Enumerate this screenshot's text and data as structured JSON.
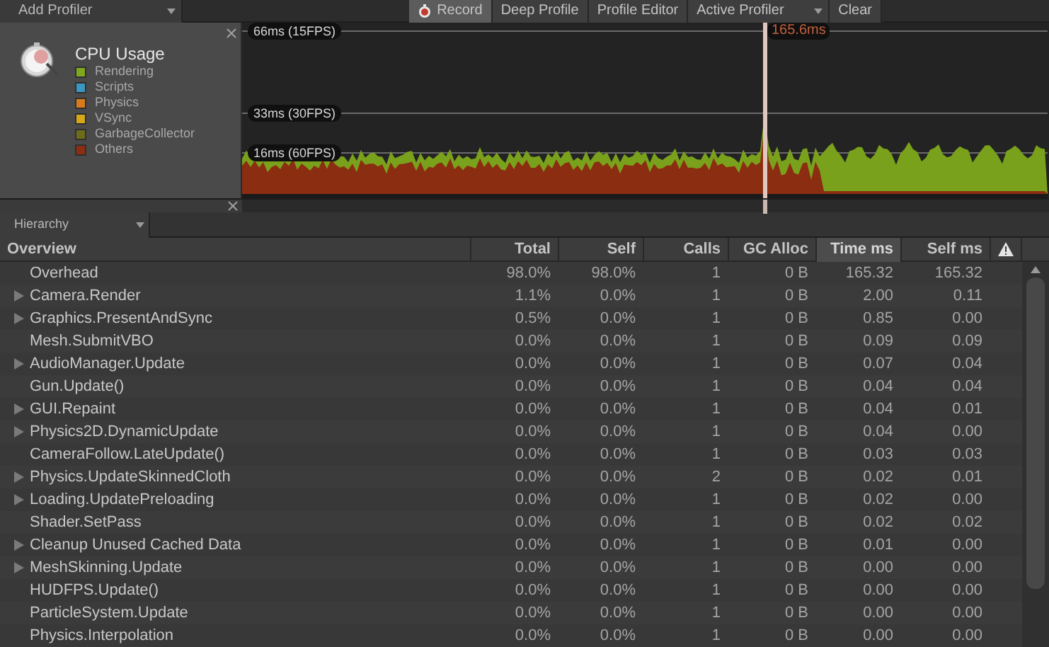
{
  "toolbar": {
    "add_profiler": "Add Profiler",
    "buttons": [
      {
        "label": "Record",
        "kind": "record",
        "selected": true
      },
      {
        "label": "Deep Profile",
        "kind": "plain",
        "selected": false
      },
      {
        "label": "Profile Editor",
        "kind": "plain",
        "selected": false
      },
      {
        "label": "Active Profiler",
        "kind": "dropdown",
        "selected": false
      },
      {
        "label": "Clear",
        "kind": "plain",
        "selected": false
      }
    ]
  },
  "cpu_panel": {
    "title": "CPU Usage",
    "legend": [
      {
        "label": "Rendering",
        "color": "#7fa81e"
      },
      {
        "label": "Scripts",
        "color": "#3c96c0"
      },
      {
        "label": "Physics",
        "color": "#d87b1c"
      },
      {
        "label": "VSync",
        "color": "#d4a81a"
      },
      {
        "label": "GarbageCollector",
        "color": "#6c6c1c"
      },
      {
        "label": "Others",
        "color": "#8b2d10"
      }
    ]
  },
  "graph": {
    "lines": [
      "66ms (15FPS)",
      "33ms (30FPS)",
      "16ms (60FPS)"
    ],
    "selected_frame": "165.6ms"
  },
  "view_mode": "Hierarchy",
  "table": {
    "columns": [
      {
        "label": "Overview",
        "selected": false
      },
      {
        "label": "Total",
        "selected": false
      },
      {
        "label": "Self",
        "selected": false
      },
      {
        "label": "Calls",
        "selected": false
      },
      {
        "label": "GC Alloc",
        "selected": false
      },
      {
        "label": "Time ms",
        "selected": true
      },
      {
        "label": "Self ms",
        "selected": false
      }
    ],
    "rows": [
      {
        "expandable": false,
        "cells": [
          "Overhead",
          "98.0%",
          "98.0%",
          "1",
          "0 B",
          "165.32",
          "165.32"
        ]
      },
      {
        "expandable": true,
        "cells": [
          "Camera.Render",
          "1.1%",
          "0.0%",
          "1",
          "0 B",
          "2.00",
          "0.11"
        ]
      },
      {
        "expandable": true,
        "cells": [
          "Graphics.PresentAndSync",
          "0.5%",
          "0.0%",
          "1",
          "0 B",
          "0.85",
          "0.00"
        ]
      },
      {
        "expandable": false,
        "cells": [
          "Mesh.SubmitVBO",
          "0.0%",
          "0.0%",
          "1",
          "0 B",
          "0.09",
          "0.09"
        ]
      },
      {
        "expandable": true,
        "cells": [
          "AudioManager.Update",
          "0.0%",
          "0.0%",
          "1",
          "0 B",
          "0.07",
          "0.04"
        ]
      },
      {
        "expandable": false,
        "cells": [
          "Gun.Update()",
          "0.0%",
          "0.0%",
          "1",
          "0 B",
          "0.04",
          "0.04"
        ]
      },
      {
        "expandable": true,
        "cells": [
          "GUI.Repaint",
          "0.0%",
          "0.0%",
          "1",
          "0 B",
          "0.04",
          "0.01"
        ]
      },
      {
        "expandable": true,
        "cells": [
          "Physics2D.DynamicUpdate",
          "0.0%",
          "0.0%",
          "1",
          "0 B",
          "0.04",
          "0.00"
        ]
      },
      {
        "expandable": false,
        "cells": [
          "CameraFollow.LateUpdate()",
          "0.0%",
          "0.0%",
          "1",
          "0 B",
          "0.03",
          "0.03"
        ]
      },
      {
        "expandable": true,
        "cells": [
          "Physics.UpdateSkinnedCloth",
          "0.0%",
          "0.0%",
          "2",
          "0 B",
          "0.02",
          "0.01"
        ]
      },
      {
        "expandable": true,
        "cells": [
          "Loading.UpdatePreloading",
          "0.0%",
          "0.0%",
          "1",
          "0 B",
          "0.02",
          "0.00"
        ]
      },
      {
        "expandable": false,
        "cells": [
          "Shader.SetPass",
          "0.0%",
          "0.0%",
          "1",
          "0 B",
          "0.02",
          "0.02"
        ]
      },
      {
        "expandable": true,
        "cells": [
          "Cleanup Unused Cached Data",
          "0.0%",
          "0.0%",
          "1",
          "0 B",
          "0.01",
          "0.00"
        ]
      },
      {
        "expandable": true,
        "cells": [
          "MeshSkinning.Update",
          "0.0%",
          "0.0%",
          "1",
          "0 B",
          "0.00",
          "0.00"
        ]
      },
      {
        "expandable": false,
        "cells": [
          "HUDFPS.Update()",
          "0.0%",
          "0.0%",
          "1",
          "0 B",
          "0.00",
          "0.00"
        ]
      },
      {
        "expandable": false,
        "cells": [
          "ParticleSystem.Update",
          "0.0%",
          "0.0%",
          "1",
          "0 B",
          "0.00",
          "0.00"
        ]
      },
      {
        "expandable": false,
        "cells": [
          "Physics.Interpolation",
          "0.0%",
          "0.0%",
          "1",
          "0 B",
          "0.00",
          "0.00"
        ]
      }
    ]
  }
}
